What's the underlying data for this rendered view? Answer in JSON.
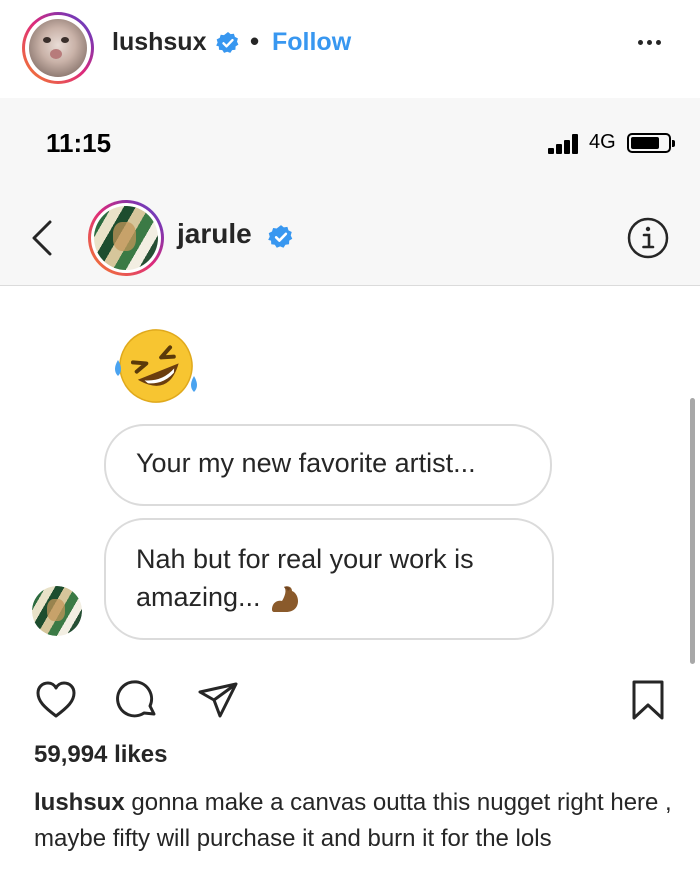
{
  "post": {
    "username": "lushsux",
    "separator": "•",
    "follow_label": "Follow",
    "more_icon": "more-horizontal-icon"
  },
  "status_bar": {
    "time": "11:15",
    "network": "4G"
  },
  "dm": {
    "username": "jarule",
    "back_icon": "chevron-left-icon",
    "info_icon": "info-icon",
    "messages": [
      {
        "emoji": "rolling-on-floor-laughing-emoji"
      },
      {
        "text": "Your my new favorite artist..."
      },
      {
        "text": "Nah but for real your work is amazing...",
        "emoji": "flexed-biceps-emoji"
      }
    ]
  },
  "engagement": {
    "likes": "59,994 likes",
    "caption_user": "lushsux",
    "caption_text": "gonna make a canvas outta this nugget right here , maybe fifty will purchase it and burn it for the lols"
  },
  "colors": {
    "accent_blue": "#3897f0",
    "verified_blue": "#3897f0",
    "text": "#262626",
    "border": "#dbdbdb",
    "header_bg": "#f7f7f7"
  }
}
